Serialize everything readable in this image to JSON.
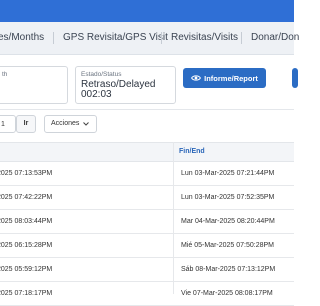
{
  "colors": {
    "primary": "#2f6fd6",
    "button": "#2b6cc4",
    "header_link": "#2a66b8"
  },
  "nav": {
    "tabs": [
      {
        "label": "es/Months"
      },
      {
        "label": "GPS Revisita/GPS Visit"
      },
      {
        "label": "Revisitas/Visits"
      },
      {
        "label": "Donar/Don"
      }
    ]
  },
  "filters": {
    "first": {
      "label": "th"
    },
    "status": {
      "label": "Estado/Status",
      "value_line1": "Retraso/Delayed",
      "value_line2": "002:03"
    }
  },
  "toolbar": {
    "report_label": "Informe/Report",
    "report_icon": "eye-icon",
    "page_value": "1",
    "go_label": "Ir",
    "actions_label": "Acciones",
    "actions_icon": "chevron-down-icon"
  },
  "table": {
    "columns": [
      "",
      "Fin/End"
    ],
    "rows": [
      {
        "start": "2025 07:13:53PM",
        "end": "Lun 03-Mar-2025 07:21:44PM"
      },
      {
        "start": "2025 07:42:22PM",
        "end": "Lun 03-Mar-2025 07:52:35PM"
      },
      {
        "start": "2025 08:03:44PM",
        "end": "Mar 04-Mar-2025 08:20:44PM"
      },
      {
        "start": "2025 06:15:28PM",
        "end": "Mié 05-Mar-2025 07:50:28PM"
      },
      {
        "start": "2025 05:59:12PM",
        "end": "Sáb 08-Mar-2025 07:13:12PM"
      },
      {
        "start": "2025 07:18:17PM",
        "end": "Vie 07-Mar-2025 08:08:17PM"
      }
    ]
  }
}
